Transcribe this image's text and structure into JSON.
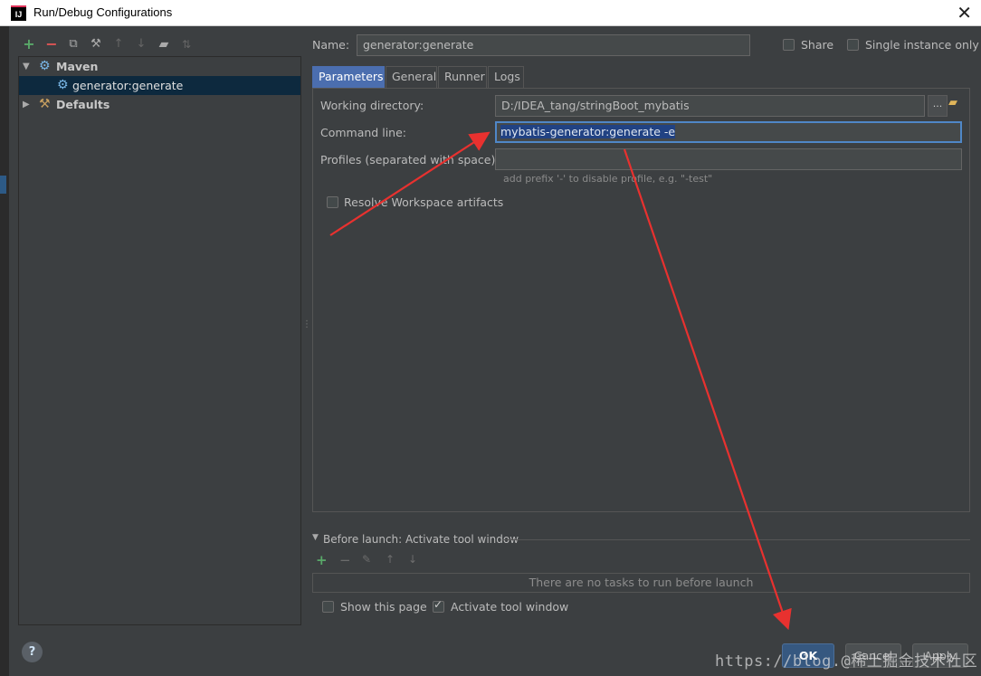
{
  "window": {
    "title": "Run/Debug Configurations",
    "app_icon_text": "IJ"
  },
  "left_toolbar": {
    "icons": [
      "add-icon",
      "remove-icon",
      "copy-icon",
      "wrench-icon",
      "move-up-icon",
      "move-down-icon",
      "folder-icon",
      "sort-icon"
    ]
  },
  "tree": {
    "maven_label": "Maven",
    "config_label": "generator:generate",
    "defaults_label": "Defaults"
  },
  "config": {
    "name_label": "Name:",
    "name_value": "generator:generate",
    "share_label": "Share",
    "single_instance_label": "Single instance only"
  },
  "tabs": [
    "Parameters",
    "General",
    "Runner",
    "Logs"
  ],
  "parameters": {
    "working_dir_label": "Working directory:",
    "working_dir_value": "D:/IDEA_tang/stringBoot_mybatis",
    "command_line_label": "Command line:",
    "command_line_value": "mybatis-generator:generate -e",
    "profiles_label": "Profiles (separated with space):",
    "profiles_value": "",
    "profiles_hint": "add prefix '-' to disable profile, e.g. \"-test\"",
    "resolve_label": "Resolve Workspace artifacts",
    "browse_label": "..."
  },
  "before_launch": {
    "header": "Before launch: Activate tool window",
    "empty_text": "There are no tasks to run before launch",
    "show_page_label": "Show this page",
    "activate_label": "Activate tool window"
  },
  "buttons": {
    "help": "?",
    "ok": "OK",
    "cancel": "Cancel",
    "apply": "Apply"
  },
  "watermark": "https://blog.@稀土掘金技术社区",
  "colors": {
    "background": "#3c3f41",
    "selection": "#0d293e",
    "active_tab": "#4b6eaf",
    "annotation_arrow": "#e8312f"
  }
}
